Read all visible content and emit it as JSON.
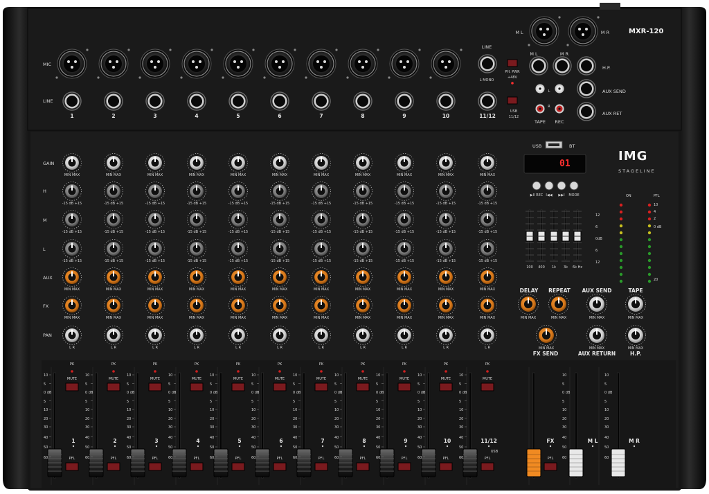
{
  "model": "MXR-120",
  "brand": {
    "logo": "IMG",
    "subline": "STAGELINE"
  },
  "row_labels": {
    "mic": "MIC",
    "line": "LINE",
    "gain": "GAIN",
    "h": "H",
    "m": "M",
    "l": "L",
    "aux": "AUX",
    "fx": "FX",
    "pan": "PAN"
  },
  "channel_numbers": [
    "1",
    "2",
    "3",
    "4",
    "5",
    "6",
    "7",
    "8",
    "9",
    "10",
    "11/12"
  ],
  "knob_scale": {
    "gain_min": "MIN",
    "gain_max": "MAX",
    "eq": "-15  dB  +15",
    "pan_l": "L",
    "pan_r": "R"
  },
  "jack_labels": {
    "line": "LINE",
    "l_mono": "L MONO",
    "ph_pwr": "PH. PWR\n+48V",
    "usb_sel": "USB\n11/12",
    "ml": "M L",
    "mr": "M R",
    "hp": "H.P.",
    "aux_send": "AUX SEND",
    "aux_ret": "AUX RET",
    "tape": "TAPE",
    "rec": "REC",
    "l": "L",
    "r": "R"
  },
  "player": {
    "usb": "USB",
    "bt": "BT",
    "display": "01",
    "buttons": [
      "▶II REC",
      "I◀◀",
      "▶▶I",
      "MODE"
    ]
  },
  "eq_graphic": {
    "bands": [
      "100",
      "400",
      "1k",
      "3k",
      "6k Hz"
    ],
    "scale": [
      "12",
      "6",
      "0dB",
      "6",
      "12"
    ]
  },
  "meter": {
    "left_labels": [
      "ON"
    ],
    "right_labels": [
      "PFL",
      "10",
      "4",
      "2",
      "0 dB",
      "",
      "",
      "",
      "",
      "20"
    ]
  },
  "fx_section": {
    "delay": "DELAY",
    "repeat": "REPEAT",
    "fx_send": "FX SEND",
    "aux_send": "AUX SEND",
    "tape": "TAPE",
    "aux_return": "AUX RETURN",
    "hp": "H.P.",
    "min": "MIN",
    "max": "MAX"
  },
  "strip": {
    "pk": "PK",
    "mute": "MUTE",
    "pfl": "PFL",
    "scale": [
      "10",
      "5",
      "0 dB",
      "5",
      "10",
      "20",
      "30",
      "40",
      "50",
      "60"
    ],
    "usb_label": "USB"
  },
  "master_labels": [
    "FX",
    "M L",
    "M R"
  ],
  "colors": {
    "body": "#141414",
    "panel": "#1e1e1e",
    "top_panel": "#191919",
    "orange": "#d8781a",
    "mute_red": "#7a1a1e",
    "fader_orange": "#f08a22",
    "fader_white": "#e8e8e8"
  }
}
